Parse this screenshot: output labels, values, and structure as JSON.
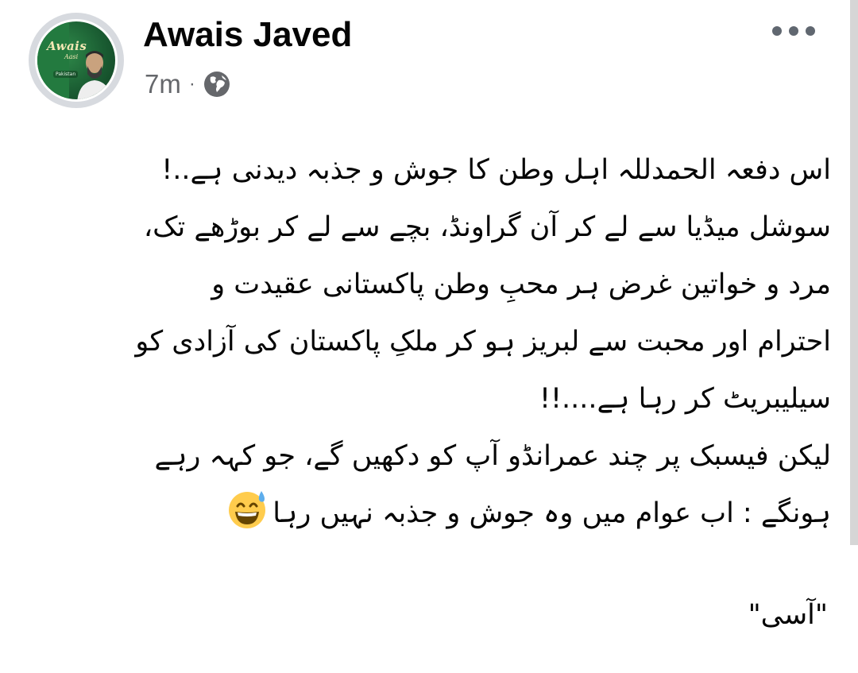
{
  "post": {
    "author": "Awais Javed",
    "time": "7m",
    "separator": "·",
    "privacy_icon": "globe-icon",
    "more_icon": "more-options-icon",
    "avatar": {
      "logo_line1": "Awais",
      "logo_line2": "Aasi",
      "badge": "Pakistan"
    },
    "body_lines": [
      "اس دفعہ الحمدللہ اہل وطن کا جوش و جذبہ دیدنی ہے..!",
      "سوشل میڈیا سے لے کر آن گراونڈ، بچے سے لے کر بوڑھے تک،",
      "مرد و خواتین غرض ہر محبِ وطن پاکستانی عقیدت و",
      "احترام اور محبت سے لبریز ہو کر ملکِ پاکستان کی آزادی کو",
      "سیلیبریٹ کر رہا ہے....!!",
      "لیکن فیسبک پر چند عمرانڈو آپ کو دکھیں گے، جو کہہ رہے",
      "ہونگے : اب عوام میں وہ جوش و جذبہ نہیں رہا"
    ],
    "emoji": "grinning-face-with-sweat-emoji",
    "signature": "\"آسی\""
  },
  "colors": {
    "text": "#050505",
    "meta": "#65676b",
    "avatar_ring": "#d7dadf",
    "avatar_green": "#1b5e33"
  }
}
